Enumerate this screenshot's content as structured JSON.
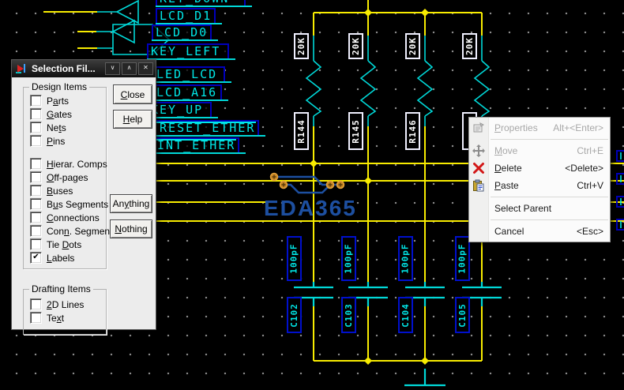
{
  "window": {
    "title": "Selection Fil...",
    "controls": {
      "collapse": "∨",
      "expand": "∧",
      "close": "✕"
    }
  },
  "selection_filter": {
    "design_items_label": "Design Items",
    "drafting_items_label": "Drafting Items",
    "design_items": [
      {
        "label": "Parts",
        "m": 1,
        "checked": false
      },
      {
        "label": "Gates",
        "m": 0,
        "checked": false
      },
      {
        "label": "Nets",
        "m": 2,
        "checked": false
      },
      {
        "label": "Pins",
        "m": 0,
        "checked": false
      },
      {
        "label": "Hierar. Comps",
        "m": 0,
        "checked": false,
        "gap": true
      },
      {
        "label": "Off-pages",
        "m": 0,
        "checked": false
      },
      {
        "label": "Buses",
        "m": 0,
        "checked": false
      },
      {
        "label": "Bus Segments",
        "m": 1,
        "checked": false
      },
      {
        "label": "Connections",
        "m": 0,
        "checked": false
      },
      {
        "label": "Conn. Segments",
        "m": 3,
        "checked": false
      },
      {
        "label": "Tie Dots",
        "m": 4,
        "checked": false
      },
      {
        "label": "Labels",
        "m": 0,
        "checked": true
      }
    ],
    "drafting_items": [
      {
        "label": "2D Lines",
        "m": 0,
        "checked": false
      },
      {
        "label": "Text",
        "m": 2,
        "checked": false
      }
    ],
    "buttons": [
      {
        "label": "Close",
        "m": 0
      },
      {
        "label": "Help",
        "m": 0
      },
      {
        "label": "Anything",
        "m": 2
      },
      {
        "label": "Nothing",
        "m": 0
      }
    ]
  },
  "context_menu": {
    "items": [
      {
        "type": "item",
        "label": "Properties",
        "shortcut": "Alt+<Enter>",
        "icon": "properties-icon",
        "disabled": true,
        "m": 0
      },
      {
        "type": "separator"
      },
      {
        "type": "item",
        "label": "Move",
        "shortcut": "Ctrl+E",
        "icon": "move-icon",
        "disabled": true,
        "m": 0
      },
      {
        "type": "item",
        "label": "Delete",
        "shortcut": "<Delete>",
        "icon": "delete-icon",
        "disabled": false,
        "m": 0
      },
      {
        "type": "item",
        "label": "Paste",
        "shortcut": "Ctrl+V",
        "icon": "paste-icon",
        "disabled": false,
        "m": 0
      },
      {
        "type": "separator"
      },
      {
        "type": "item",
        "label": "Select Parent",
        "shortcut": "",
        "icon": "",
        "disabled": false
      },
      {
        "type": "separator"
      },
      {
        "type": "item",
        "label": "Cancel",
        "shortcut": "<Esc>",
        "icon": "",
        "disabled": false
      }
    ]
  },
  "schematic": {
    "net_labels": [
      {
        "text": "KEY_DOWN",
        "overline": false
      },
      {
        "text": "LCD_D1",
        "overline": false
      },
      {
        "text": "LCD_D0",
        "overline": false
      },
      {
        "text": "KEY_LEFT",
        "overline": false
      },
      {
        "text": "LED_LCD",
        "overline": false
      },
      {
        "text": "LCD_A16",
        "overline": false
      },
      {
        "text": "KEY_UP",
        "overline": false
      },
      {
        "text": "'RESET_ETHER",
        "overline": true
      },
      {
        "text": "'INT_ETHER",
        "overline": true
      }
    ],
    "resistors": {
      "value": "20K",
      "refs": [
        "R144",
        "R145",
        "R146",
        ""
      ]
    },
    "capacitors": {
      "value": "100pF",
      "refs": [
        "C102",
        "C103",
        "C104",
        "C105"
      ]
    },
    "watermark": "EDA365",
    "colors": {
      "wire": "#f8ec00",
      "symbol": "#00d8d8",
      "label_text": "#00e8e8",
      "label_box": "#0000bb",
      "highlight": "#ffffff",
      "logo": "#1d4fa0",
      "pad": "#cf8a2e"
    }
  }
}
